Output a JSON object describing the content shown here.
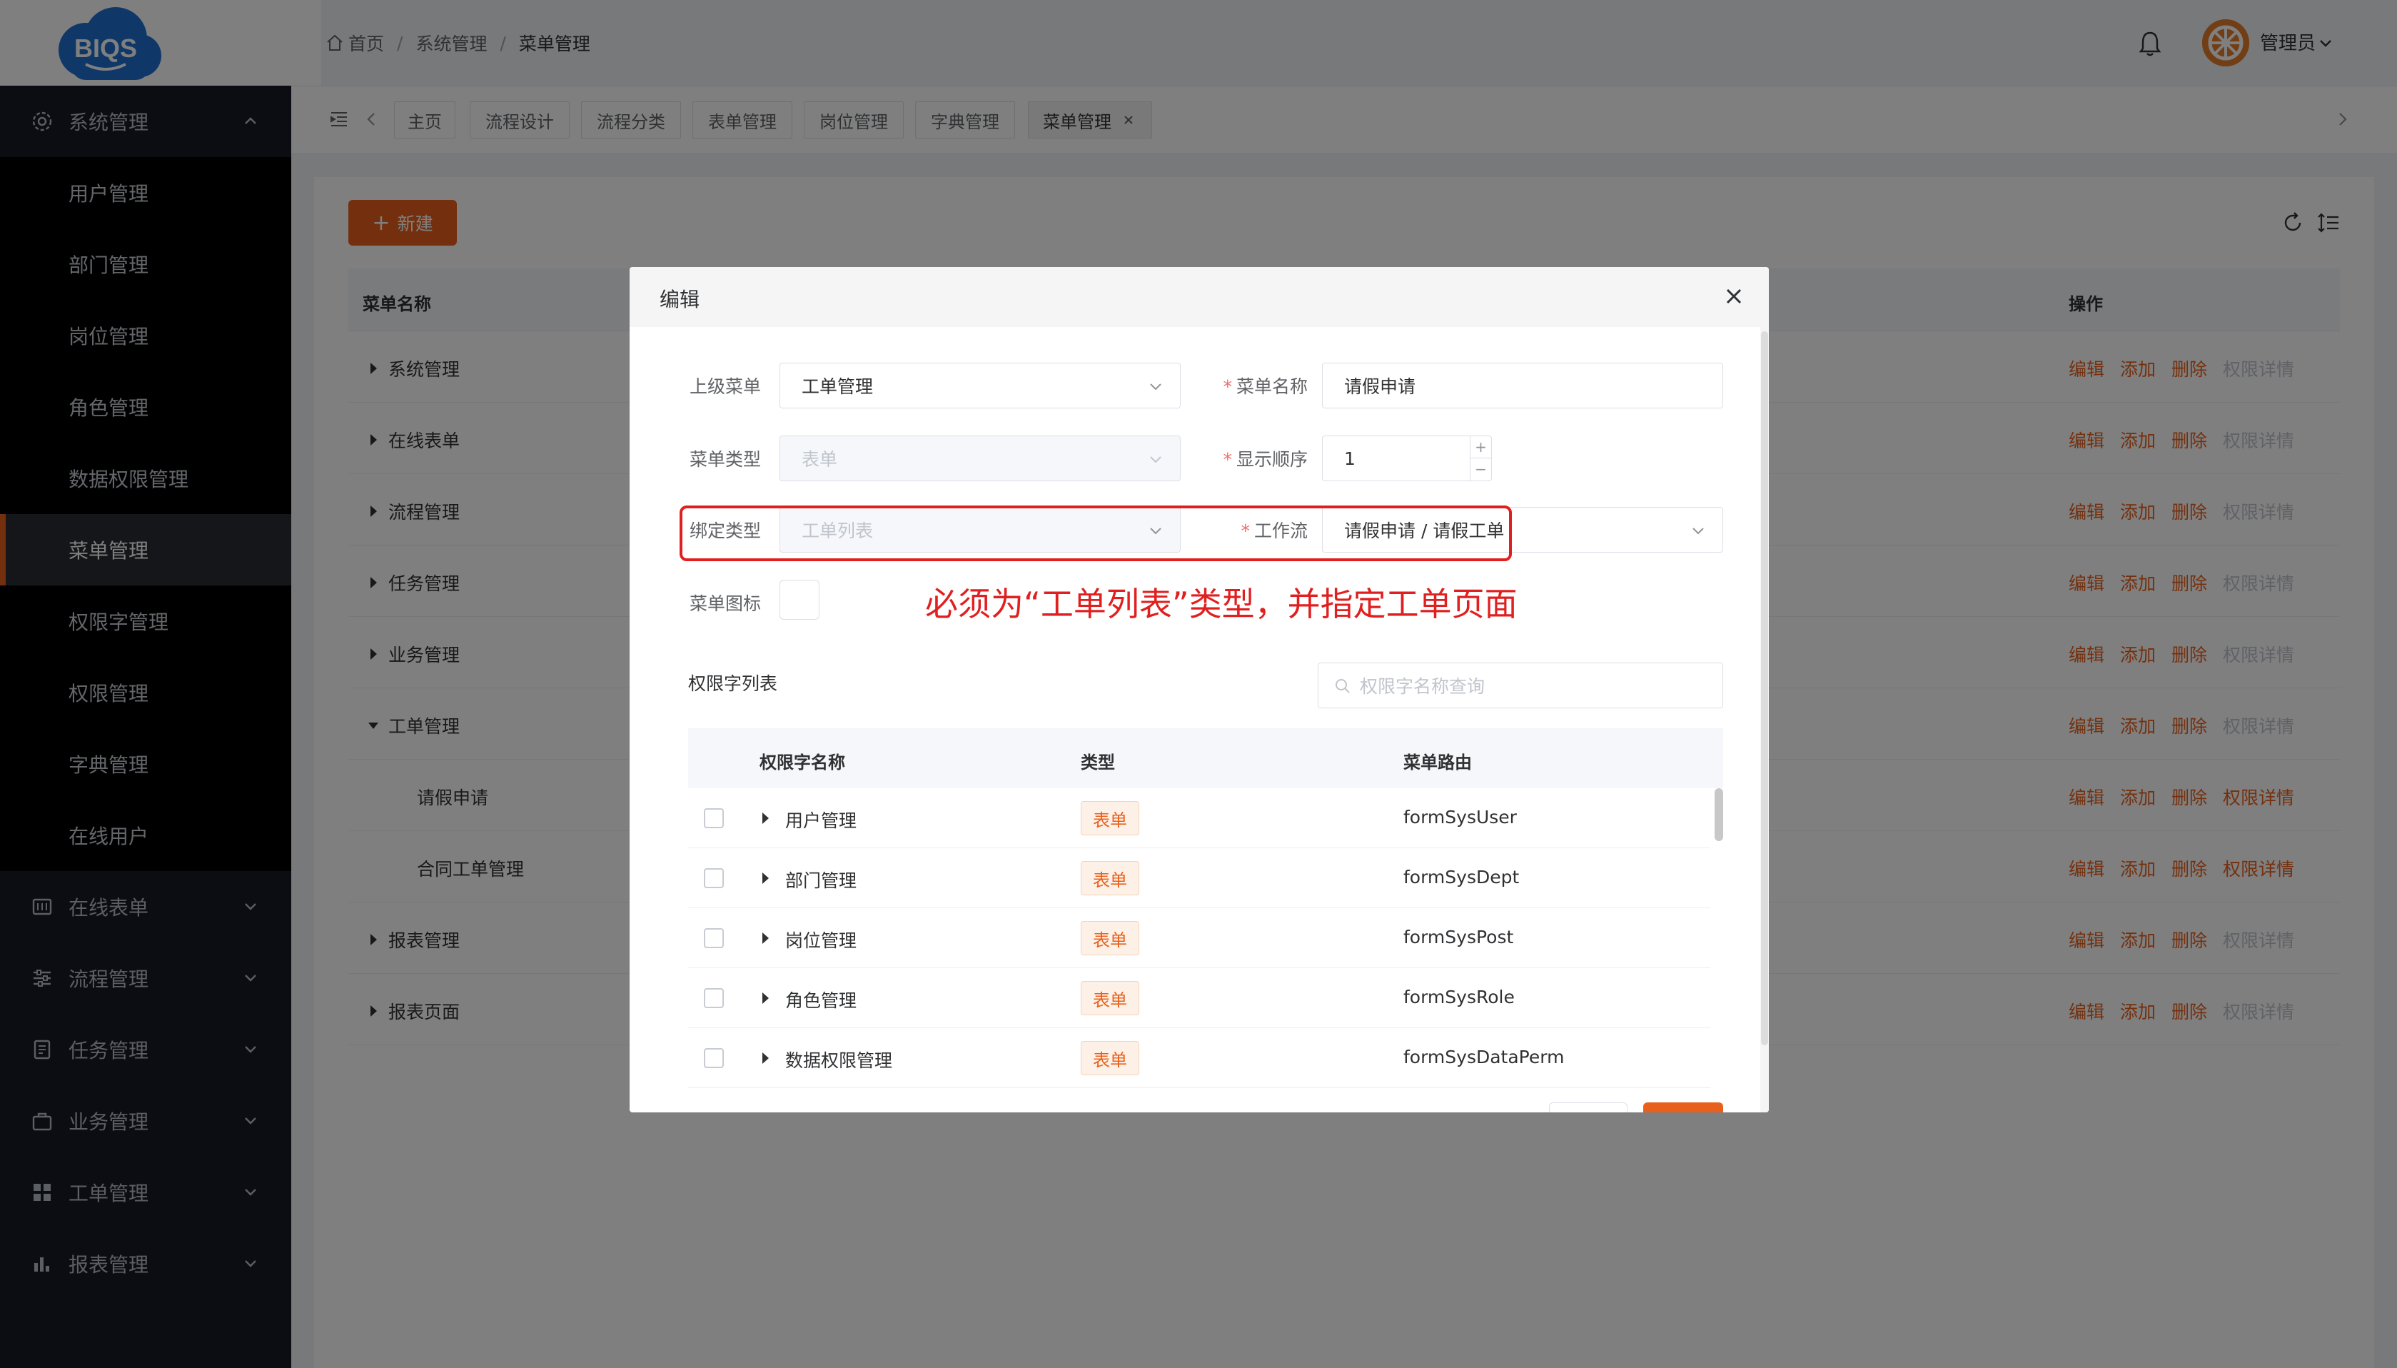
{
  "app": {
    "logo_text": "BIQS"
  },
  "breadcrumb": {
    "home": "首页",
    "sep1": "/",
    "level1": "系统管理",
    "sep2": "/",
    "current": "菜单管理"
  },
  "user": {
    "name": "管理员"
  },
  "sidebar": {
    "group_system": "系统管理",
    "items": [
      "用户管理",
      "部门管理",
      "岗位管理",
      "角色管理",
      "数据权限管理",
      "菜单管理",
      "权限字管理",
      "权限管理",
      "字典管理",
      "在线用户"
    ],
    "groups_after": [
      "在线表单",
      "流程管理",
      "任务管理",
      "业务管理",
      "工单管理",
      "报表管理"
    ]
  },
  "tabs": [
    "主页",
    "流程设计",
    "流程分类",
    "表单管理",
    "岗位管理",
    "字典管理",
    "菜单管理"
  ],
  "toolbar": {
    "new_label": "新建"
  },
  "table": {
    "headers": {
      "name": "菜单名称",
      "actions": "操作"
    },
    "rows": [
      {
        "name": "系统管理",
        "perm_active": false
      },
      {
        "name": "在线表单",
        "perm_active": false
      },
      {
        "name": "流程管理",
        "perm_active": false
      },
      {
        "name": "任务管理",
        "perm_active": false
      },
      {
        "name": "业务管理",
        "perm_active": false
      },
      {
        "name": "工单管理",
        "perm_active": false
      },
      {
        "name": "请假申请",
        "perm_active": true
      },
      {
        "name": "合同工单管理",
        "perm_active": true
      },
      {
        "name": "报表管理",
        "perm_active": false
      },
      {
        "name": "报表页面",
        "perm_active": false
      }
    ],
    "action_labels": {
      "edit": "编辑",
      "add": "添加",
      "delete": "删除",
      "perm": "权限详情"
    }
  },
  "modal": {
    "title": "编辑",
    "parent_menu_label": "上级菜单",
    "parent_menu_value": "工单管理",
    "menu_name_label": "菜单名称",
    "menu_name_value": "请假申请",
    "menu_type_label": "菜单类型",
    "menu_type_value": "表单",
    "order_label": "显示顺序",
    "order_value": "1",
    "bind_type_label": "绑定类型",
    "bind_type_value": "工单列表",
    "workflow_label": "工作流",
    "workflow_value": "请假申请 / 请假工单",
    "icon_label": "菜单图标",
    "annotation": "必须为“工单列表”类型，并指定工单页面",
    "perm_list_label": "权限字列表",
    "perm_search_placeholder": "权限字名称查询",
    "perm_table": {
      "headers": {
        "name": "权限字名称",
        "type": "类型",
        "route": "菜单路由"
      },
      "rows": [
        {
          "name": "用户管理",
          "type": "表单",
          "route": "formSysUser"
        },
        {
          "name": "部门管理",
          "type": "表单",
          "route": "formSysDept"
        },
        {
          "name": "岗位管理",
          "type": "表单",
          "route": "formSysPost"
        },
        {
          "name": "角色管理",
          "type": "表单",
          "route": "formSysRole"
        },
        {
          "name": "数据权限管理",
          "type": "表单",
          "route": "formSysDataPerm"
        }
      ]
    }
  },
  "colors": {
    "accent": "#e8601c",
    "sidebar_bg": "#171a24",
    "annotation": "#e02020"
  }
}
